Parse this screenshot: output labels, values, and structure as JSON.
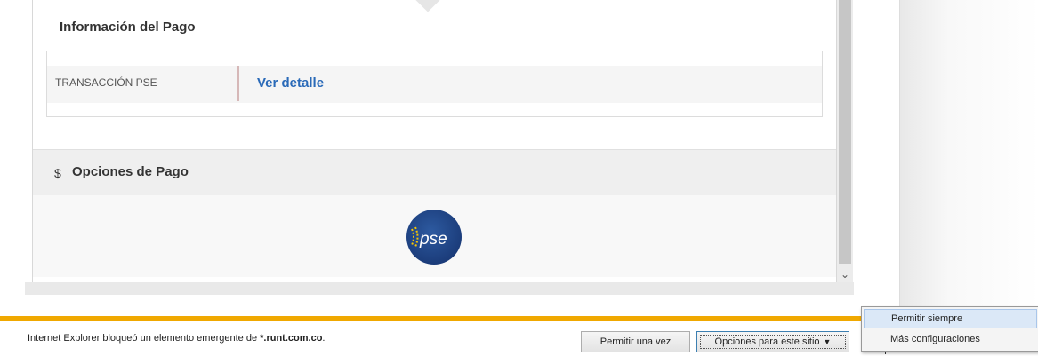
{
  "payment_info": {
    "title": "Información del Pago",
    "row_label": "TRANSACCIÓN PSE",
    "row_link": "Ver detalle"
  },
  "payment_options": {
    "dollar": "$",
    "title": "Opciones de Pago",
    "logo_text": "pse"
  },
  "notification_bar": {
    "message_prefix": "Internet Explorer bloqueó un elemento emergente de ",
    "message_site": "*.runt.com.co",
    "message_suffix": ".",
    "allow_once": "Permitir una vez",
    "site_options": "Opciones para este sitio",
    "caret": "▼"
  },
  "site_options_menu": {
    "items": [
      "Permitir siempre",
      "Más configuraciones"
    ]
  },
  "colors": {
    "link": "#2a6ab8",
    "notification_stripe": "#f0a800",
    "pse_blue": "#1f4a8c"
  }
}
